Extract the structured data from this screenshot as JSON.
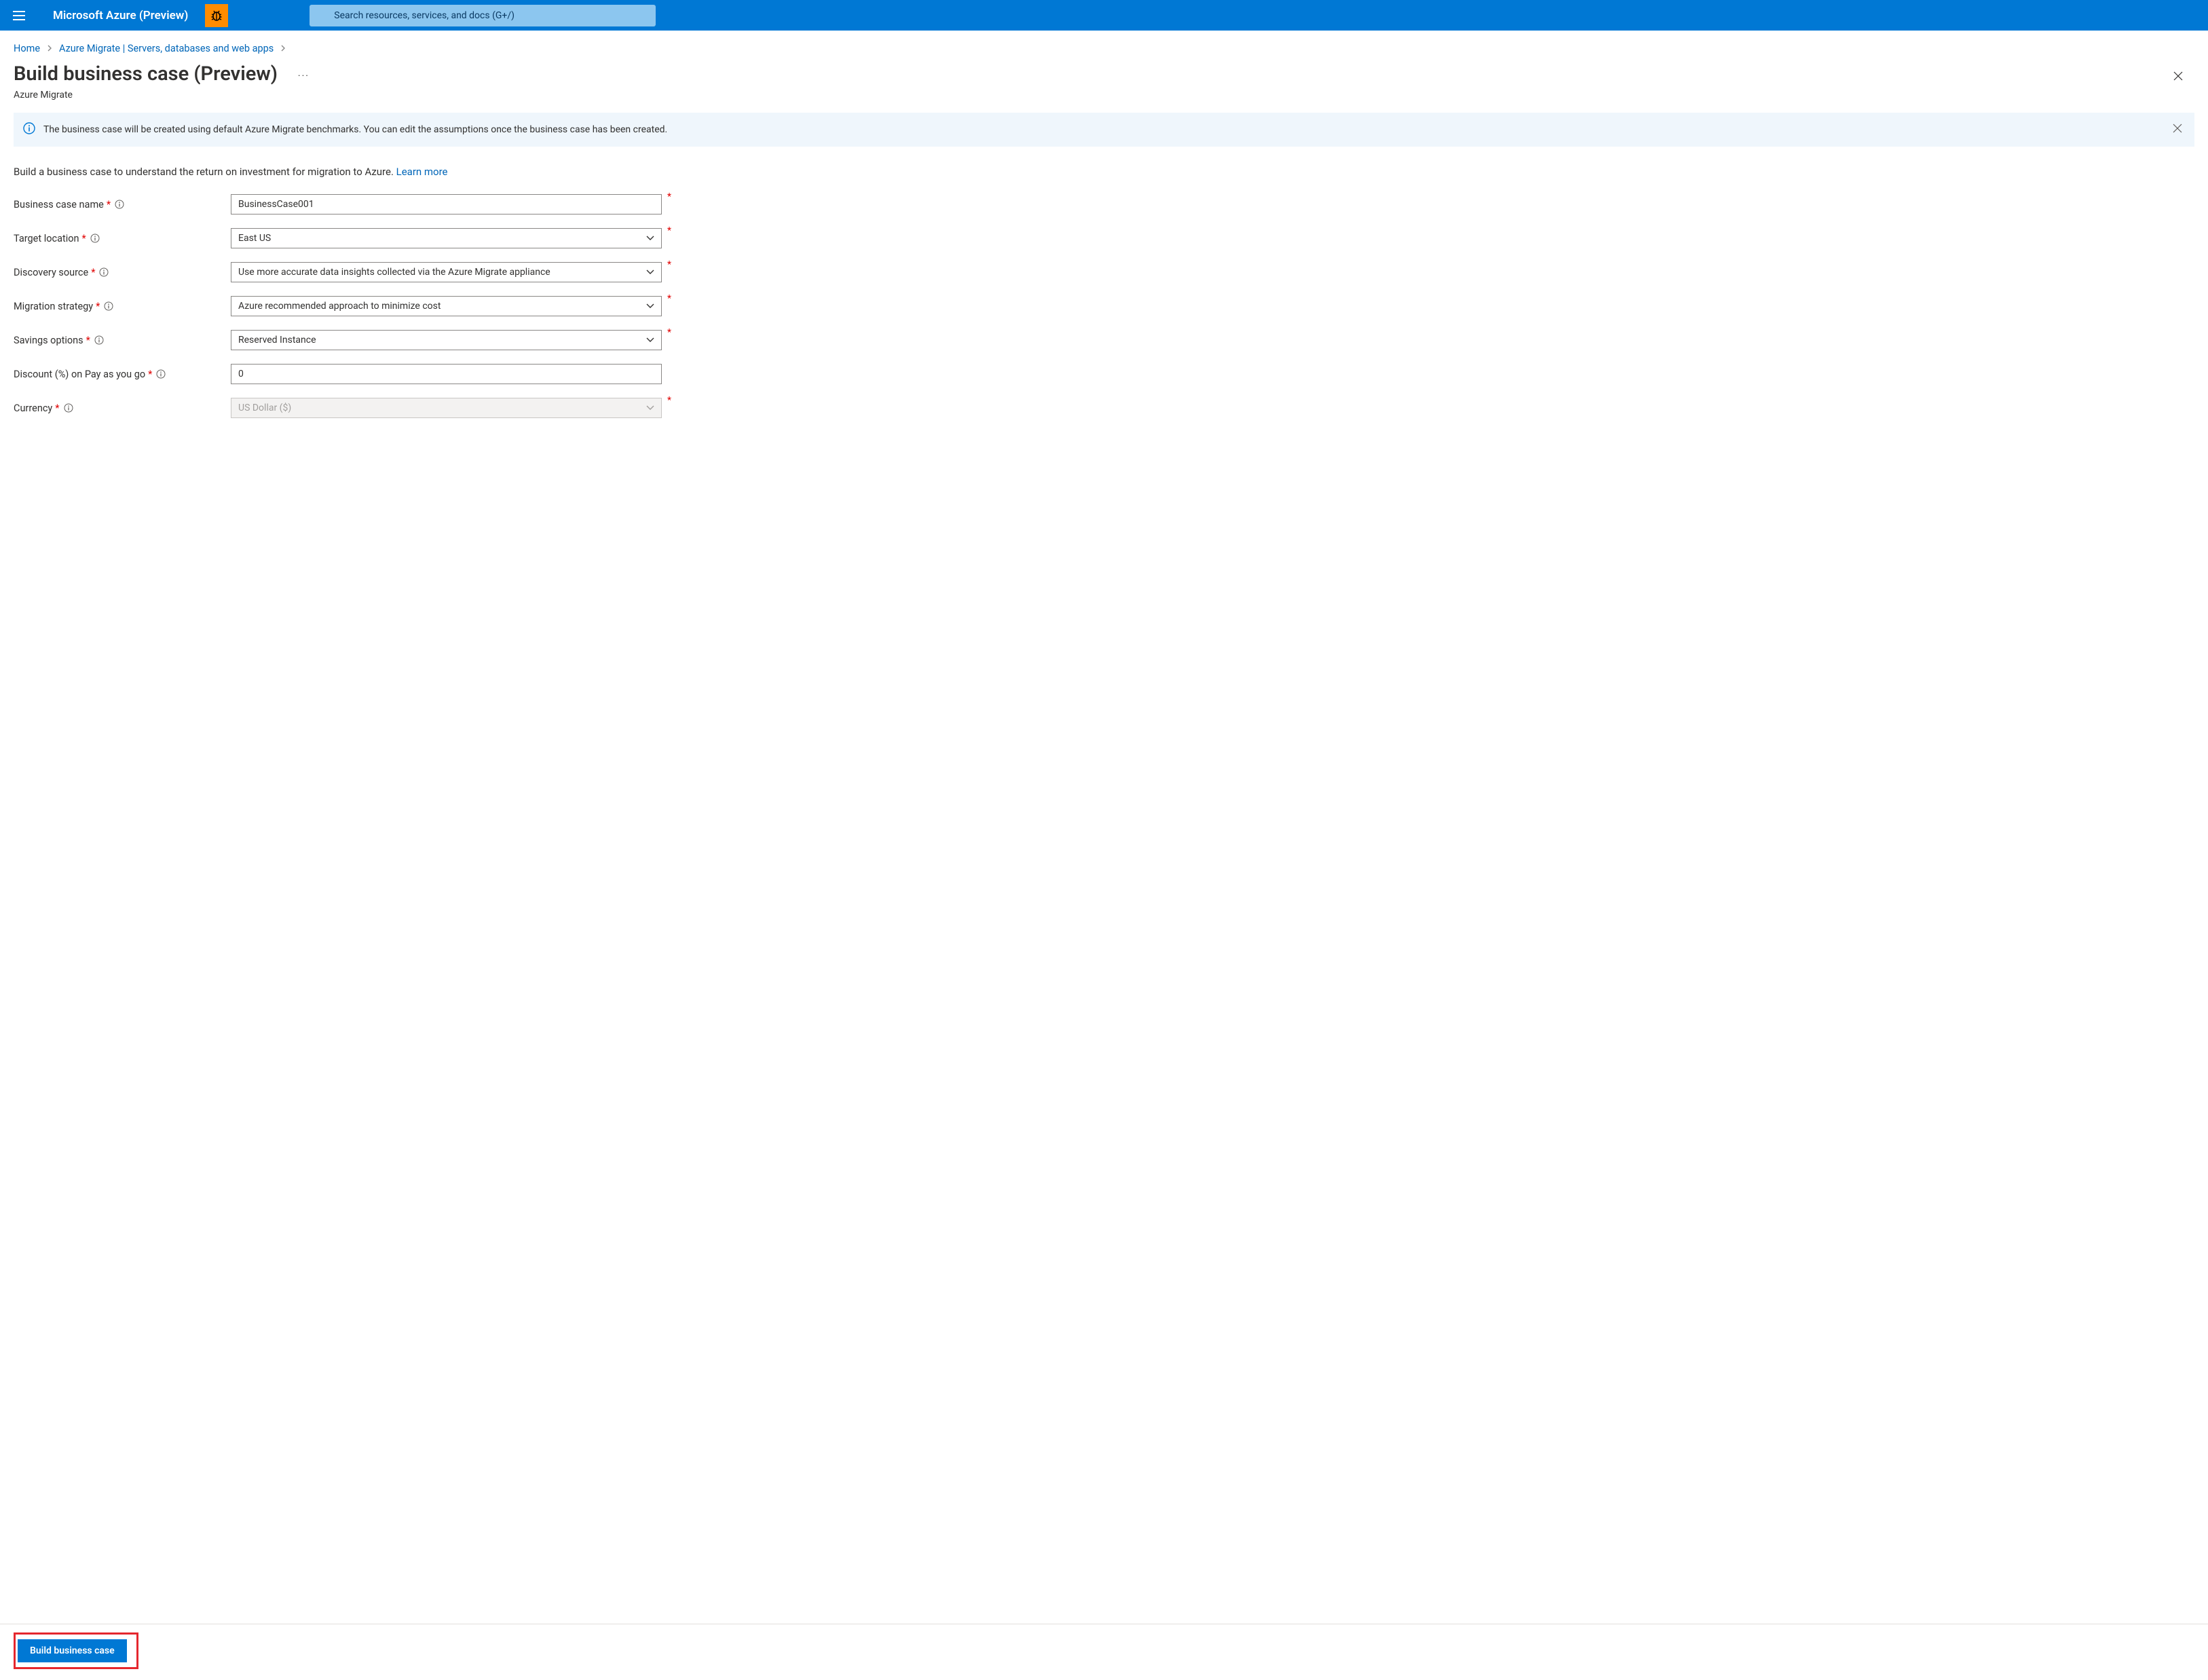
{
  "topbar": {
    "brand": "Microsoft Azure (Preview)",
    "search_placeholder": "Search resources, services, and docs (G+/)"
  },
  "breadcrumb": {
    "home": "Home",
    "migrate": "Azure Migrate | Servers, databases and web apps"
  },
  "header": {
    "title": "Build business case (Preview)",
    "subtitle": "Azure Migrate"
  },
  "banner": {
    "text": "The business case will be created using default Azure Migrate benchmarks. You can edit the assumptions once the business case has been created."
  },
  "intro": {
    "text": "Build a business case to understand the return on investment for migration to Azure. ",
    "learn": "Learn more"
  },
  "form": {
    "name": {
      "label": "Business case name",
      "value": "BusinessCase001"
    },
    "location": {
      "label": "Target location",
      "value": "East US"
    },
    "discovery": {
      "label": "Discovery source",
      "value": "Use more accurate data insights collected via the Azure Migrate appliance"
    },
    "strategy": {
      "label": "Migration strategy",
      "value": "Azure recommended approach to minimize cost"
    },
    "savings": {
      "label": "Savings options",
      "value": "Reserved Instance"
    },
    "discount": {
      "label": "Discount (%) on Pay as you go",
      "value": "0"
    },
    "currency": {
      "label": "Currency",
      "value": "US Dollar ($)"
    }
  },
  "footer": {
    "build_label": "Build business case"
  }
}
